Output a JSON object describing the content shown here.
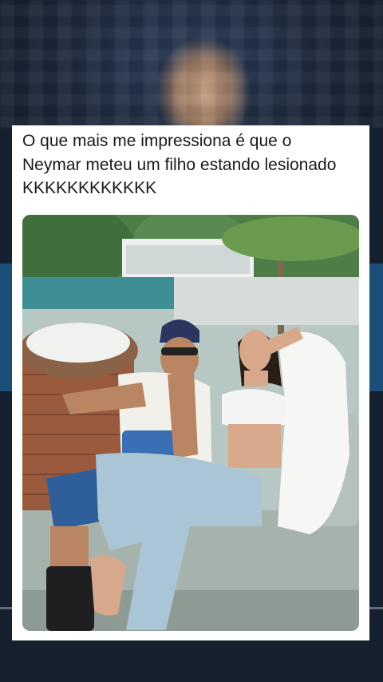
{
  "post": {
    "caption": "O que mais me impressiona é que o Neymar meteu um filho estando lesionado KKKKKKKKKKKK",
    "photo_alt": "photo"
  },
  "colors": {
    "card_background": "#ffffff",
    "caption_text": "#1a1a1a",
    "pitch_green": "#2b6a35"
  }
}
